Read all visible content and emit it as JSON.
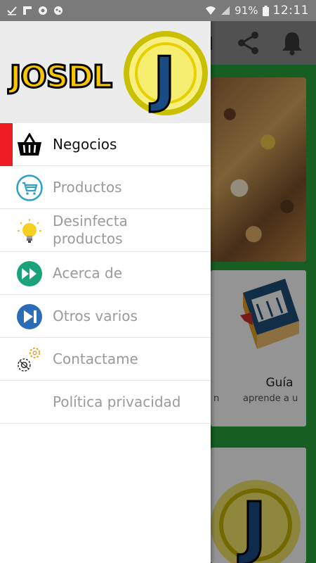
{
  "status_bar": {
    "battery": "91%",
    "time": "12:11"
  },
  "drawer": {
    "logo_text": "JOSDL",
    "logo_badge": "J",
    "items": [
      {
        "label": "Negocios",
        "icon": "basket-icon",
        "active": true
      },
      {
        "label": "Productos",
        "icon": "cart-icon",
        "active": false
      },
      {
        "label": "Desinfecta\nproductos",
        "icon": "lightbulb-icon",
        "active": false
      },
      {
        "label": "Acerca de",
        "icon": "fast-forward-icon",
        "active": false
      },
      {
        "label": "Otros varios",
        "icon": "skip-next-icon",
        "active": false
      },
      {
        "label": "Contactame",
        "icon": "gears-icon",
        "active": false
      },
      {
        "label": "Política privacidad",
        "icon": "none",
        "active": false
      }
    ]
  },
  "background": {
    "guide_title": "Guía",
    "guide_subtitle": "aprende a u",
    "guide_left_fragment": "n"
  },
  "colors": {
    "active_indicator": "#ee1c24",
    "app_green": "#27a33a",
    "logo_yellow": "#f5d000"
  }
}
